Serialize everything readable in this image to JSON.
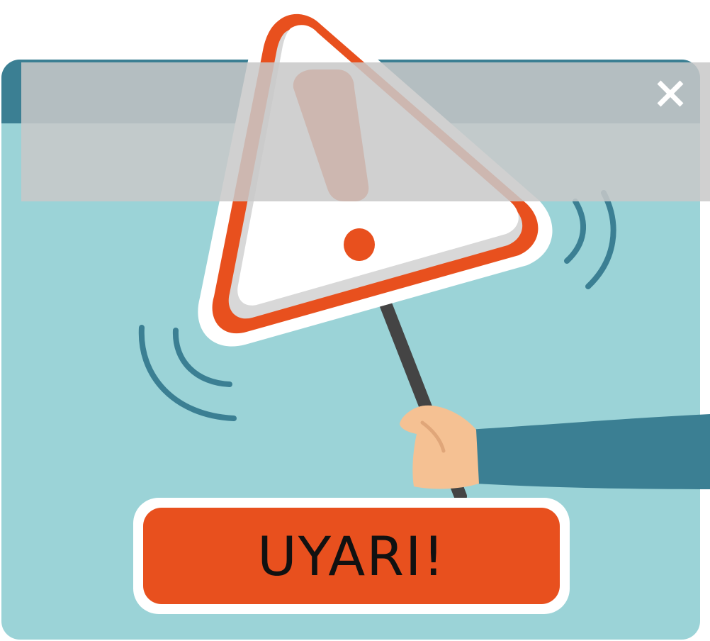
{
  "dialog": {
    "warning_text": "UYARI!",
    "close_icon": "close-icon",
    "illustration_icon": "warning-triangle-sign-icon"
  },
  "colors": {
    "window_background": "#9bd3d7",
    "titlebar": "#3b7f93",
    "accent_orange": "#e8501e",
    "overlay_gray": "#c8c8c8",
    "skin": "#f5c193",
    "sleeve": "#3b7f93"
  }
}
